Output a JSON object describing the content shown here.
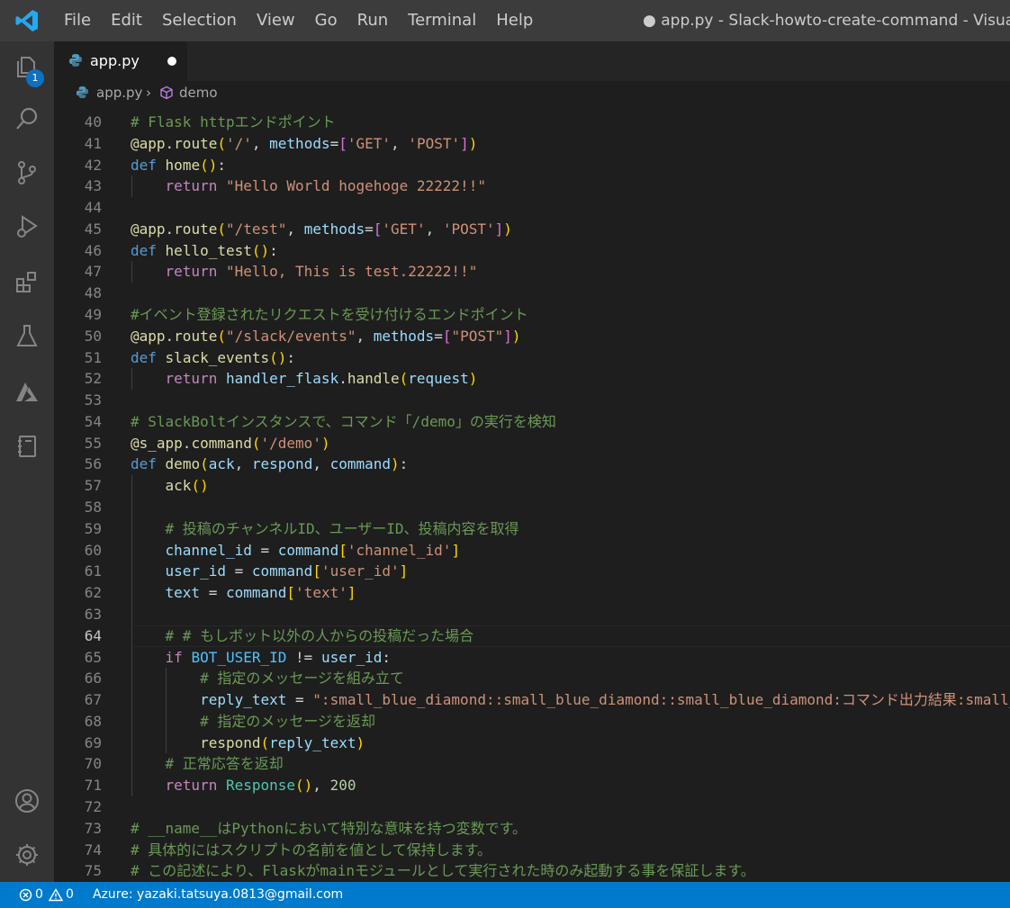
{
  "titlebar": {
    "menu": [
      "File",
      "Edit",
      "Selection",
      "View",
      "Go",
      "Run",
      "Terminal",
      "Help"
    ],
    "window_title": "● app.py - Slack-howto-create-command - Visual Studio Code"
  },
  "activitybar": {
    "explorer_badge": "1",
    "items": [
      "explorer",
      "search",
      "source-control",
      "run-debug",
      "extensions",
      "testing",
      "azure",
      "notebook"
    ],
    "bottom": [
      "accounts",
      "manage"
    ]
  },
  "tab": {
    "label": "app.py",
    "dirty": true
  },
  "breadcrumb": {
    "file": "app.py",
    "symbol": "demo"
  },
  "editor": {
    "active_line": 64,
    "lines": [
      {
        "n": "40",
        "t": [
          [
            "cmt",
            "# Flask httpエンドポイント"
          ]
        ]
      },
      {
        "n": "41",
        "t": [
          [
            "dec",
            "@app"
          ],
          [
            "",
            "."
          ],
          [
            "dec",
            "route"
          ],
          [
            "b1",
            "("
          ],
          [
            "str",
            "'/'"
          ],
          [
            "",
            ", "
          ],
          [
            "var",
            "methods"
          ],
          [
            "",
            "="
          ],
          [
            "b2",
            "["
          ],
          [
            "str",
            "'GET'"
          ],
          [
            "",
            ", "
          ],
          [
            "str",
            "'POST'"
          ],
          [
            "b2",
            "]"
          ],
          [
            "b1",
            ")"
          ]
        ]
      },
      {
        "n": "42",
        "t": [
          [
            "kw",
            "def"
          ],
          [
            "",
            " "
          ],
          [
            "fn",
            "home"
          ],
          [
            "b1",
            "()"
          ],
          [
            "",
            ":"
          ]
        ]
      },
      {
        "n": "43",
        "t": [
          [
            "",
            "    "
          ],
          [
            "ctl",
            "return"
          ],
          [
            "",
            " "
          ],
          [
            "str",
            "\"Hello World hogehoge 22222!!\""
          ]
        ]
      },
      {
        "n": "44",
        "t": []
      },
      {
        "n": "45",
        "t": [
          [
            "dec",
            "@app"
          ],
          [
            "",
            "."
          ],
          [
            "dec",
            "route"
          ],
          [
            "b1",
            "("
          ],
          [
            "str",
            "\"/test\""
          ],
          [
            "",
            ", "
          ],
          [
            "var",
            "methods"
          ],
          [
            "",
            "="
          ],
          [
            "b2",
            "["
          ],
          [
            "str",
            "'GET'"
          ],
          [
            "",
            ", "
          ],
          [
            "str",
            "'POST'"
          ],
          [
            "b2",
            "]"
          ],
          [
            "b1",
            ")"
          ]
        ]
      },
      {
        "n": "46",
        "t": [
          [
            "kw",
            "def"
          ],
          [
            "",
            " "
          ],
          [
            "fn",
            "hello_test"
          ],
          [
            "b1",
            "()"
          ],
          [
            "",
            ":"
          ]
        ]
      },
      {
        "n": "47",
        "t": [
          [
            "",
            "    "
          ],
          [
            "ctl",
            "return"
          ],
          [
            "",
            " "
          ],
          [
            "str",
            "\"Hello, This is test.22222!!\""
          ]
        ]
      },
      {
        "n": "48",
        "t": []
      },
      {
        "n": "49",
        "t": [
          [
            "cmt",
            "#イベント登録されたリクエストを受け付けるエンドポイント"
          ]
        ]
      },
      {
        "n": "50",
        "t": [
          [
            "dec",
            "@app"
          ],
          [
            "",
            "."
          ],
          [
            "dec",
            "route"
          ],
          [
            "b1",
            "("
          ],
          [
            "str",
            "\"/slack/events\""
          ],
          [
            "",
            ", "
          ],
          [
            "var",
            "methods"
          ],
          [
            "",
            "="
          ],
          [
            "b2",
            "["
          ],
          [
            "str",
            "\"POST\""
          ],
          [
            "b2",
            "]"
          ],
          [
            "b1",
            ")"
          ]
        ]
      },
      {
        "n": "51",
        "t": [
          [
            "kw",
            "def"
          ],
          [
            "",
            " "
          ],
          [
            "fn",
            "slack_events"
          ],
          [
            "b1",
            "()"
          ],
          [
            "",
            ":"
          ]
        ]
      },
      {
        "n": "52",
        "t": [
          [
            "",
            "    "
          ],
          [
            "ctl",
            "return"
          ],
          [
            "",
            " "
          ],
          [
            "var",
            "handler_flask"
          ],
          [
            "",
            "."
          ],
          [
            "fn",
            "handle"
          ],
          [
            "b1",
            "("
          ],
          [
            "var",
            "request"
          ],
          [
            "b1",
            ")"
          ]
        ]
      },
      {
        "n": "53",
        "t": []
      },
      {
        "n": "54",
        "t": [
          [
            "cmt",
            "# SlackBoltインスタンスで、コマンド「/demo」の実行を検知"
          ]
        ]
      },
      {
        "n": "55",
        "t": [
          [
            "dec",
            "@s_app"
          ],
          [
            "",
            "."
          ],
          [
            "dec",
            "command"
          ],
          [
            "b1",
            "("
          ],
          [
            "str",
            "'/demo'"
          ],
          [
            "b1",
            ")"
          ]
        ]
      },
      {
        "n": "56",
        "t": [
          [
            "kw",
            "def"
          ],
          [
            "",
            " "
          ],
          [
            "fn",
            "demo"
          ],
          [
            "b1",
            "("
          ],
          [
            "var",
            "ack"
          ],
          [
            "",
            ", "
          ],
          [
            "var",
            "respond"
          ],
          [
            "",
            ", "
          ],
          [
            "var",
            "command"
          ],
          [
            "b1",
            ")"
          ],
          [
            "",
            ":"
          ]
        ]
      },
      {
        "n": "57",
        "t": [
          [
            "",
            "    "
          ],
          [
            "fn",
            "ack"
          ],
          [
            "b1",
            "()"
          ]
        ]
      },
      {
        "n": "58",
        "t": []
      },
      {
        "n": "59",
        "t": [
          [
            "",
            "    "
          ],
          [
            "cmt",
            "# 投稿のチャンネルID、ユーザーID、投稿内容を取得"
          ]
        ]
      },
      {
        "n": "60",
        "t": [
          [
            "",
            "    "
          ],
          [
            "var",
            "channel_id"
          ],
          [
            "",
            " = "
          ],
          [
            "var",
            "command"
          ],
          [
            "b1",
            "["
          ],
          [
            "str",
            "'channel_id'"
          ],
          [
            "b1",
            "]"
          ]
        ]
      },
      {
        "n": "61",
        "t": [
          [
            "",
            "    "
          ],
          [
            "var",
            "user_id"
          ],
          [
            "",
            " = "
          ],
          [
            "var",
            "command"
          ],
          [
            "b1",
            "["
          ],
          [
            "str",
            "'user_id'"
          ],
          [
            "b1",
            "]"
          ]
        ]
      },
      {
        "n": "62",
        "t": [
          [
            "",
            "    "
          ],
          [
            "var",
            "text"
          ],
          [
            "",
            " = "
          ],
          [
            "var",
            "command"
          ],
          [
            "b1",
            "["
          ],
          [
            "str",
            "'text'"
          ],
          [
            "b1",
            "]"
          ]
        ]
      },
      {
        "n": "63",
        "t": []
      },
      {
        "n": "64",
        "t": [
          [
            "",
            "    "
          ],
          [
            "cmt",
            "# # もしボット以外の人からの投稿だった場合"
          ]
        ]
      },
      {
        "n": "65",
        "t": [
          [
            "",
            "    "
          ],
          [
            "ctl",
            "if"
          ],
          [
            "",
            " "
          ],
          [
            "const",
            "BOT_USER_ID"
          ],
          [
            "",
            " != "
          ],
          [
            "var",
            "user_id"
          ],
          [
            "",
            ":"
          ]
        ]
      },
      {
        "n": "66",
        "t": [
          [
            "",
            "        "
          ],
          [
            "cmt",
            "# 指定のメッセージを組み立て"
          ]
        ]
      },
      {
        "n": "67",
        "t": [
          [
            "",
            "        "
          ],
          [
            "var",
            "reply_text"
          ],
          [
            "",
            " = "
          ],
          [
            "str",
            "\":small_blue_diamond::small_blue_diamond::small_blue_diamond:コマンド出力結果:small_blue_diamond:\""
          ]
        ]
      },
      {
        "n": "68",
        "t": [
          [
            "",
            "        "
          ],
          [
            "cmt",
            "# 指定のメッセージを返却"
          ]
        ]
      },
      {
        "n": "69",
        "t": [
          [
            "",
            "        "
          ],
          [
            "fn",
            "respond"
          ],
          [
            "b1",
            "("
          ],
          [
            "var",
            "reply_text"
          ],
          [
            "b1",
            ")"
          ]
        ]
      },
      {
        "n": "70",
        "t": [
          [
            "",
            "    "
          ],
          [
            "cmt",
            "# 正常応答を返却"
          ]
        ]
      },
      {
        "n": "71",
        "t": [
          [
            "",
            "    "
          ],
          [
            "ctl",
            "return"
          ],
          [
            "",
            " "
          ],
          [
            "cls",
            "Response"
          ],
          [
            "b1",
            "()"
          ],
          [
            "",
            ", "
          ],
          [
            "num",
            "200"
          ]
        ]
      },
      {
        "n": "72",
        "t": []
      },
      {
        "n": "73",
        "t": [
          [
            "cmt",
            "# __name__はPythonにおいて特別な意味を持つ変数です。"
          ]
        ]
      },
      {
        "n": "74",
        "t": [
          [
            "cmt",
            "# 具体的にはスクリプトの名前を値として保持します。"
          ]
        ]
      },
      {
        "n": "75",
        "t": [
          [
            "cmt",
            "# この記述により、Flaskがmainモジュールとして実行された時のみ起動する事を保証します。"
          ]
        ]
      }
    ]
  },
  "statusbar": {
    "errors": "0",
    "warnings": "0",
    "azure": "Azure: yazaki.tatsuya.0813@gmail.com"
  }
}
